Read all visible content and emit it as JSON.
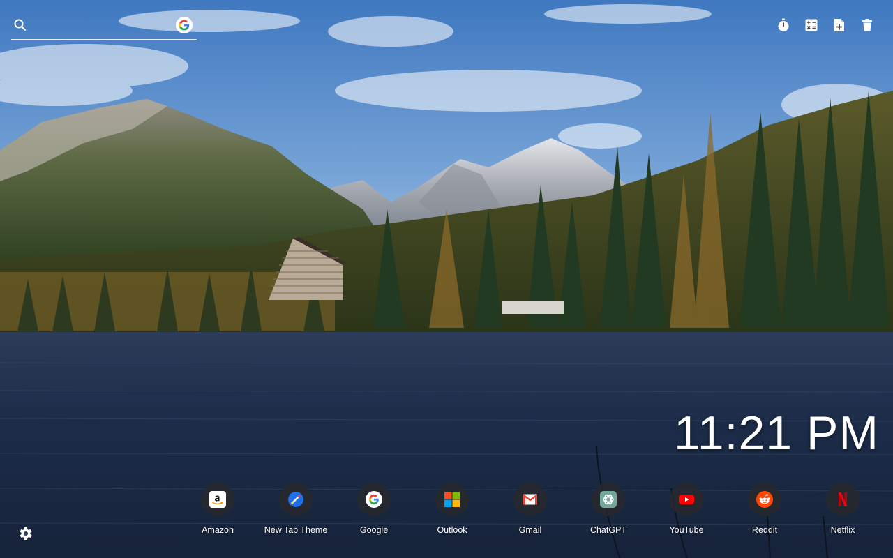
{
  "search": {
    "placeholder": "",
    "engine_icon": "google-icon"
  },
  "toolbar": [
    {
      "name": "timer-icon"
    },
    {
      "name": "calculator-icon"
    },
    {
      "name": "add-note-icon"
    },
    {
      "name": "trash-icon"
    }
  ],
  "clock": {
    "time": "11:21 PM"
  },
  "shortcuts": [
    {
      "label": "Amazon",
      "icon": "amazon-icon"
    },
    {
      "label": "New Tab Theme",
      "icon": "new-tab-theme-icon"
    },
    {
      "label": "Google",
      "icon": "google-icon"
    },
    {
      "label": "Outlook",
      "icon": "microsoft-icon"
    },
    {
      "label": "Gmail",
      "icon": "gmail-icon"
    },
    {
      "label": "ChatGPT",
      "icon": "chatgpt-icon"
    },
    {
      "label": "YouTube",
      "icon": "youtube-icon"
    },
    {
      "label": "Reddit",
      "icon": "reddit-icon"
    },
    {
      "label": "Netflix",
      "icon": "netflix-icon"
    }
  ],
  "settings": {
    "icon": "gear-icon"
  },
  "colors": {
    "sky_top": "#4a82c6",
    "lake": "#1c2b44",
    "shortcut_bg": "#2a2a2e"
  }
}
